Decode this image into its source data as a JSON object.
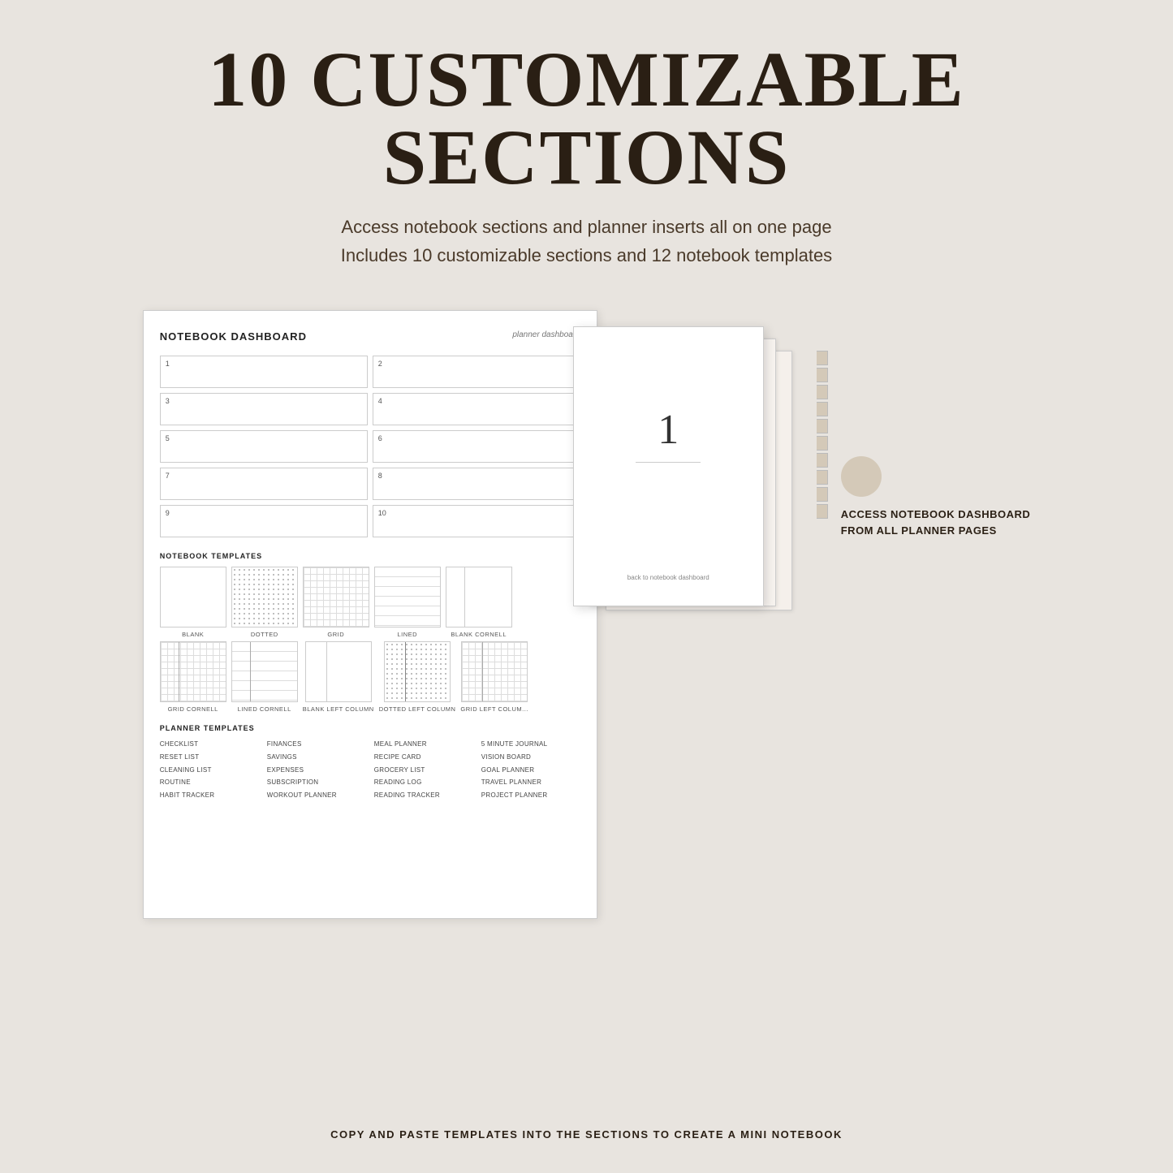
{
  "page": {
    "background_color": "#e8e4df",
    "main_title": "10 CUSTOMIZABLE SECTIONS",
    "subtitle_line1": "Access notebook sections and planner inserts all on one page",
    "subtitle_line2": "Includes 10 customizable sections and 12 notebook templates",
    "bottom_cta": "COPY AND PASTE TEMPLATES INTO THE SECTIONS TO CREATE A MINI NOTEBOOK"
  },
  "dashboard": {
    "title": "NOTEBOOK DASHBOARD",
    "right_label": "planner dashboard",
    "sections": [
      {
        "number": "1"
      },
      {
        "number": "2"
      },
      {
        "number": "3"
      },
      {
        "number": "4"
      },
      {
        "number": "5"
      },
      {
        "number": "6"
      },
      {
        "number": "7"
      },
      {
        "number": "8"
      },
      {
        "number": "9"
      },
      {
        "number": "10"
      }
    ],
    "notebook_templates_heading": "NOTEBOOK TEMPLATES",
    "notebook_templates": [
      {
        "label": "BLANK",
        "style": "blank"
      },
      {
        "label": "DOTTED",
        "style": "dotted"
      },
      {
        "label": "GRID",
        "style": "grid"
      },
      {
        "label": "LINED",
        "style": "lined"
      },
      {
        "label": "BLANK CORNELL",
        "style": "blank-cornell"
      },
      {
        "label": "GRID CORNELL",
        "style": "grid-cornell"
      },
      {
        "label": "LINED CORNELL",
        "style": "lined-cornell"
      },
      {
        "label": "BLANK LEFT COLUMN",
        "style": "blank-left-col"
      },
      {
        "label": "DOTTED LEFT COLUMN",
        "style": "dotted-left-col"
      },
      {
        "label": "GRID LEFT COLUM...",
        "style": "grid-left-col"
      }
    ],
    "planner_templates_heading": "PLANNER TEMPLATES",
    "planner_templates": [
      "CHECKLIST",
      "FINANCES",
      "MEAL PLANNER",
      "5 MINUTE JOURNAL",
      "RESET LIST",
      "SAVINGS",
      "RECIPE CARD",
      "VISION BOARD",
      "CLEANING LIST",
      "EXPENSES",
      "GROCERY LIST",
      "GOAL PLANNER",
      "ROUTINE",
      "SUBSCRIPTION",
      "READING LOG",
      "TRAVEL PLANNER",
      "HABIT TRACKER",
      "WORKOUT PLANNER",
      "READING TRACKER",
      "PROJECT PLANNER"
    ]
  },
  "page_front": {
    "number": "1",
    "back_link": "back to notebook dashboard"
  },
  "right_info": {
    "text_line1": "ACCESS NOTEBOOK DASHBOARD",
    "text_line2": "FROM ALL PLANNER PAGES"
  }
}
